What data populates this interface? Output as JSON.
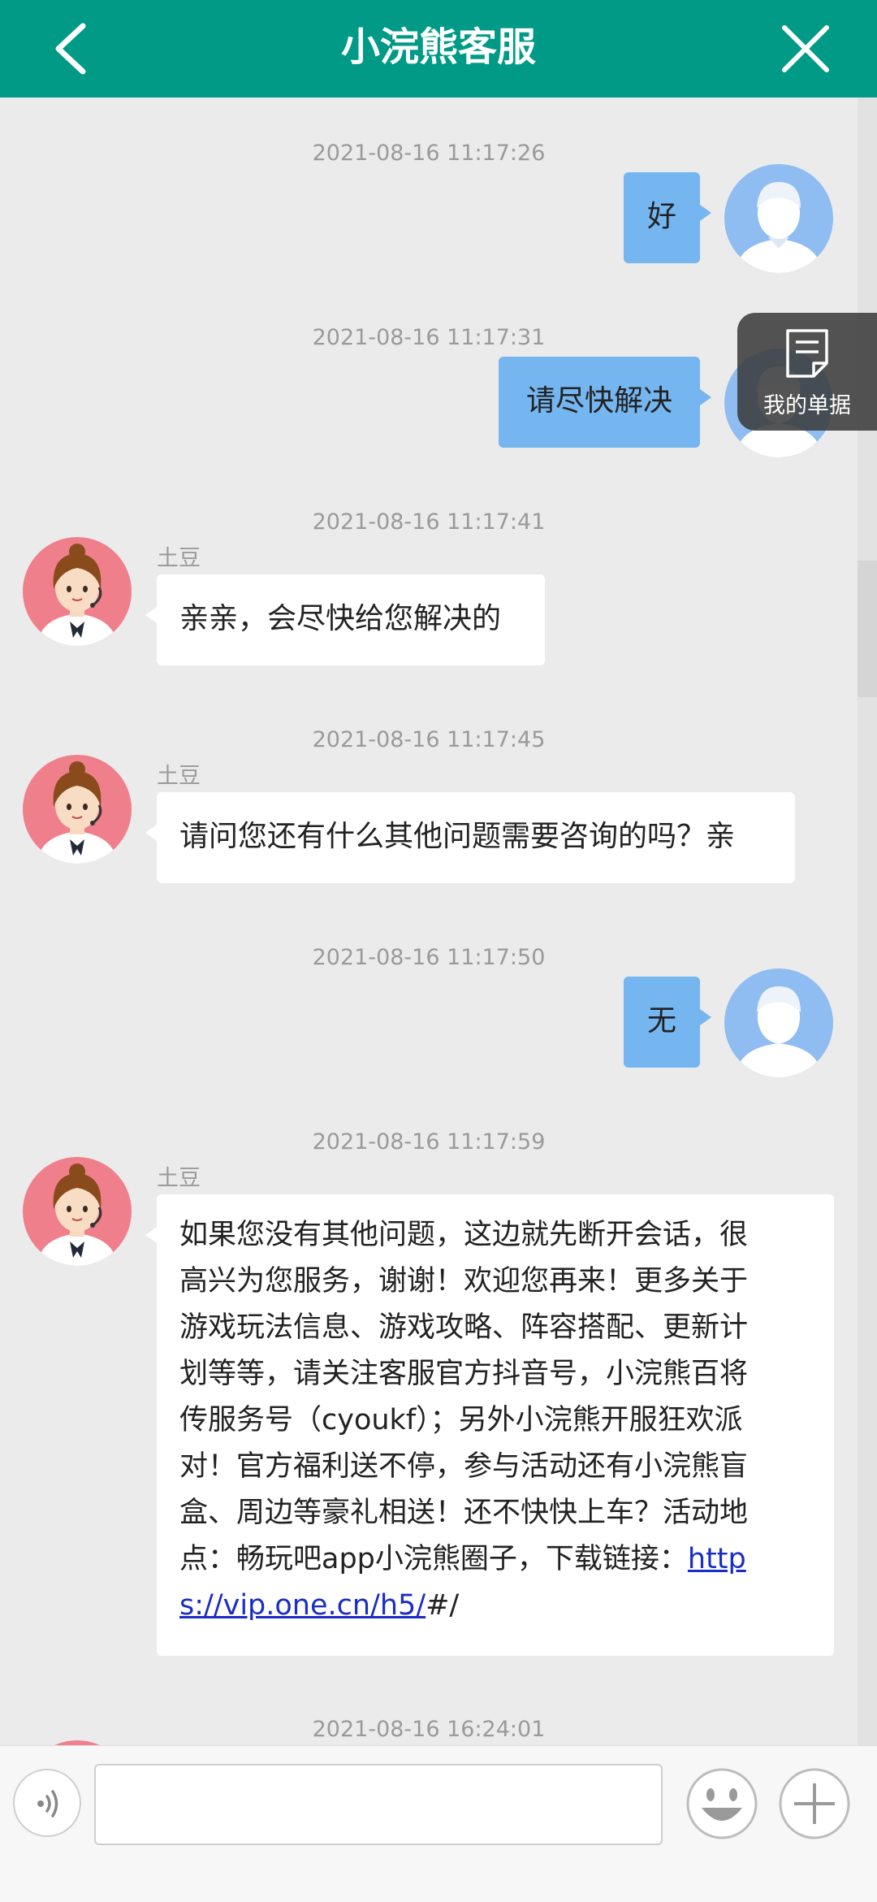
{
  "header": {
    "title": "小浣熊客服"
  },
  "receipts": {
    "label": "我的单据"
  },
  "messages": [
    {
      "time": "2021-08-16 11:17:26",
      "text": "好"
    },
    {
      "time": "2021-08-16 11:17:31",
      "text": "请尽快解决"
    },
    {
      "time": "2021-08-16 11:17:41",
      "sender": "土豆",
      "text": "亲亲，会尽快给您解决的"
    },
    {
      "time": "2021-08-16 11:17:45",
      "sender": "土豆",
      "text": "请问您还有什么其他问题需要咨询的吗？亲"
    },
    {
      "time": "2021-08-16 11:17:50",
      "text": "无"
    },
    {
      "time": "2021-08-16 11:17:59",
      "sender": "土豆",
      "lines": [
        "如果您没有其他问题，这边就先断开会话，很",
        "高兴为您服务，谢谢！欢迎您再来！更多关于",
        "游戏玩法信息、游戏攻略、阵容搭配、更新计",
        "划等等，请关注客服官方抖音号，小浣熊百将",
        "传服务号（cyoukf）；另外小浣熊开服狂欢派",
        "对！官方福利送不停，参与活动还有小浣熊盲",
        "盒、周边等豪礼相送！还不快快上车？活动地"
      ],
      "line8_text": "点：畅玩吧app小浣熊圈子，下载链接：",
      "line8_link": "http",
      "line9_link": "s://vip.one.cn/h5/",
      "line9_text": "#/"
    },
    {
      "time": "2021-08-16 16:24:01"
    }
  ],
  "colors": {
    "header": "#009a87",
    "my_bubble": "#75b6f0",
    "agent_bubble": "#ffffff",
    "background": "#ebebeb",
    "link": "#1a2dc4"
  }
}
